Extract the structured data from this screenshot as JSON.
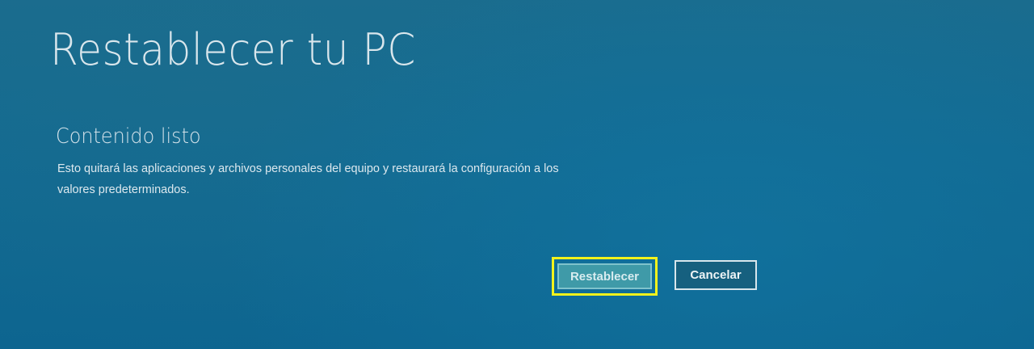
{
  "window": {
    "title": "Restablecer tu PC"
  },
  "content": {
    "subtitle": "Contenido listo",
    "description_line1": "Esto quitará las aplicaciones y archivos personales del equipo y restaurará la configuración a los",
    "description_line2": "valores predeterminados."
  },
  "actions": {
    "reset_label": "Restablecer",
    "cancel_label": "Cancelar",
    "highlight_color": "#f2f21c"
  },
  "colors": {
    "background": "#126a92",
    "reset_button": "#3f9aa8"
  }
}
